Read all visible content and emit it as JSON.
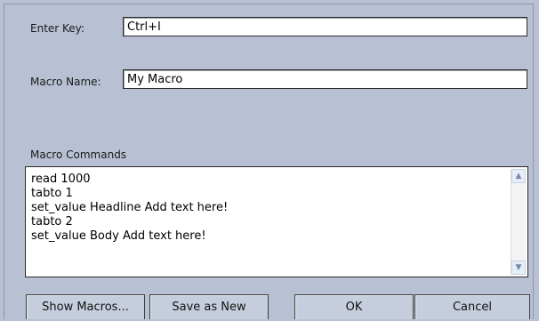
{
  "enter_key": {
    "label": "Enter Key:",
    "value": "Ctrl+I"
  },
  "macro_name": {
    "label": "Macro Name:",
    "value": "My Macro"
  },
  "macro_commands": {
    "label": "Macro Commands",
    "text": "read 1000\ntabto 1\nset_value Headline Add text here!\ntabto 2\nset_value Body Add text here!"
  },
  "buttons": {
    "show_macros": "Show Macros...",
    "save_as_new": "Save as New",
    "ok": "OK",
    "cancel": "Cancel"
  }
}
